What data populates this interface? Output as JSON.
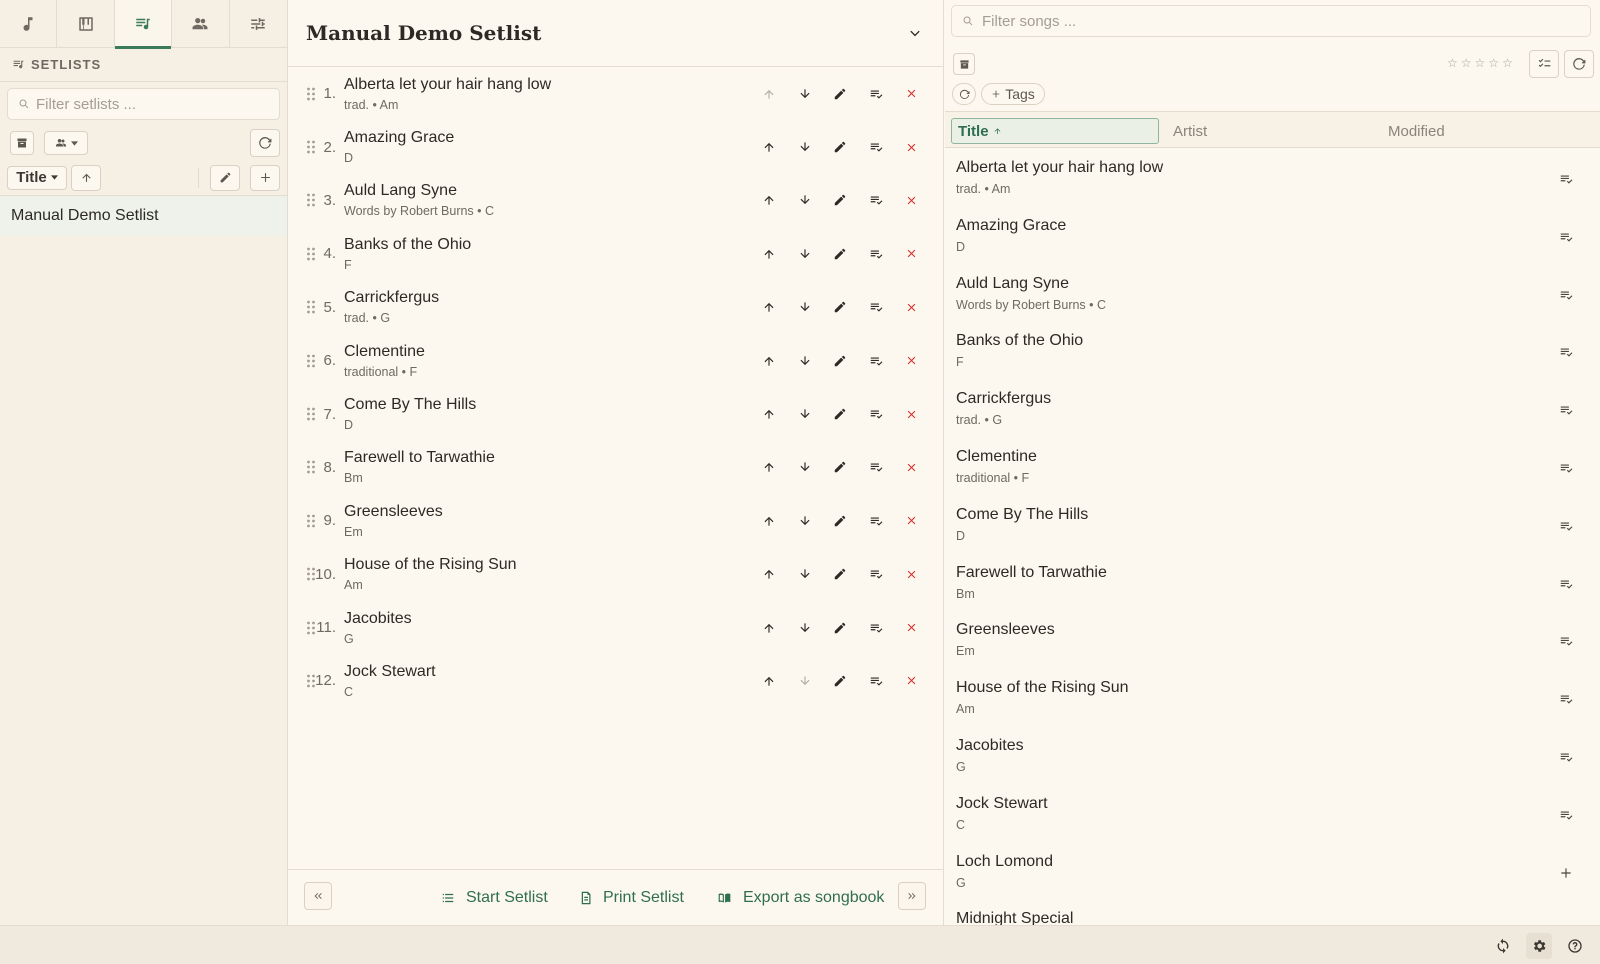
{
  "sidebar": {
    "tabs": [
      {
        "icon": "music-note-icon"
      },
      {
        "icon": "piano-icon"
      },
      {
        "icon": "setlist-icon",
        "active": true
      },
      {
        "icon": "people-icon"
      },
      {
        "icon": "sliders-icon"
      }
    ],
    "header": "SETLISTS",
    "filter_placeholder": "Filter setlists ...",
    "sort_label": "Title",
    "setlists": [
      "Manual Demo Setlist"
    ]
  },
  "setlist": {
    "title": "Manual Demo Setlist",
    "songs": [
      {
        "num": "1.",
        "title": "Alberta let your hair hang low",
        "sub": "trad. • Am"
      },
      {
        "num": "2.",
        "title": "Amazing Grace",
        "sub": "D"
      },
      {
        "num": "3.",
        "title": "Auld Lang Syne",
        "sub": "Words by Robert Burns • C"
      },
      {
        "num": "4.",
        "title": "Banks of the Ohio",
        "sub": "F"
      },
      {
        "num": "5.",
        "title": "Carrickfergus",
        "sub": "trad. • G"
      },
      {
        "num": "6.",
        "title": "Clementine",
        "sub": "traditional • F"
      },
      {
        "num": "7.",
        "title": "Come By The Hills",
        "sub": "D"
      },
      {
        "num": "8.",
        "title": "Farewell to Tarwathie",
        "sub": "Bm"
      },
      {
        "num": "9.",
        "title": "Greensleeves",
        "sub": "Em"
      },
      {
        "num": "10.",
        "title": "House of the Rising Sun",
        "sub": "Am"
      },
      {
        "num": "11.",
        "title": "Jacobites",
        "sub": "G"
      },
      {
        "num": "12.",
        "title": "Jock Stewart",
        "sub": "C"
      }
    ],
    "footer": {
      "start_label": "Start Setlist",
      "print_label": "Print Setlist",
      "export_label": "Export as songbook"
    }
  },
  "library": {
    "filter_placeholder": "Filter songs ...",
    "tags_label": "Tags",
    "columns": {
      "title": "Title",
      "artist": "Artist",
      "modified": "Modified"
    },
    "songs": [
      {
        "title": "Alberta let your hair hang low",
        "sub": "trad. • Am",
        "action": "in-setlist"
      },
      {
        "title": "Amazing Grace",
        "sub": "D",
        "action": "in-setlist"
      },
      {
        "title": "Auld Lang Syne",
        "sub": "Words by Robert Burns • C",
        "action": "in-setlist"
      },
      {
        "title": "Banks of the Ohio",
        "sub": "F",
        "action": "in-setlist"
      },
      {
        "title": "Carrickfergus",
        "sub": "trad. • G",
        "action": "in-setlist"
      },
      {
        "title": "Clementine",
        "sub": "traditional • F",
        "action": "in-setlist"
      },
      {
        "title": "Come By The Hills",
        "sub": "D",
        "action": "in-setlist"
      },
      {
        "title": "Farewell to Tarwathie",
        "sub": "Bm",
        "action": "in-setlist"
      },
      {
        "title": "Greensleeves",
        "sub": "Em",
        "action": "in-setlist"
      },
      {
        "title": "House of the Rising Sun",
        "sub": "Am",
        "action": "in-setlist"
      },
      {
        "title": "Jacobites",
        "sub": "G",
        "action": "in-setlist"
      },
      {
        "title": "Jock Stewart",
        "sub": "C",
        "action": "in-setlist"
      },
      {
        "title": "Loch Lomond",
        "sub": "G",
        "action": "add"
      },
      {
        "title": "Midnight Special",
        "sub": "",
        "action": "add"
      }
    ]
  },
  "colors": {
    "accent": "#3b7a5a",
    "delete": "#d2302b",
    "background": "#fdf8ef"
  }
}
